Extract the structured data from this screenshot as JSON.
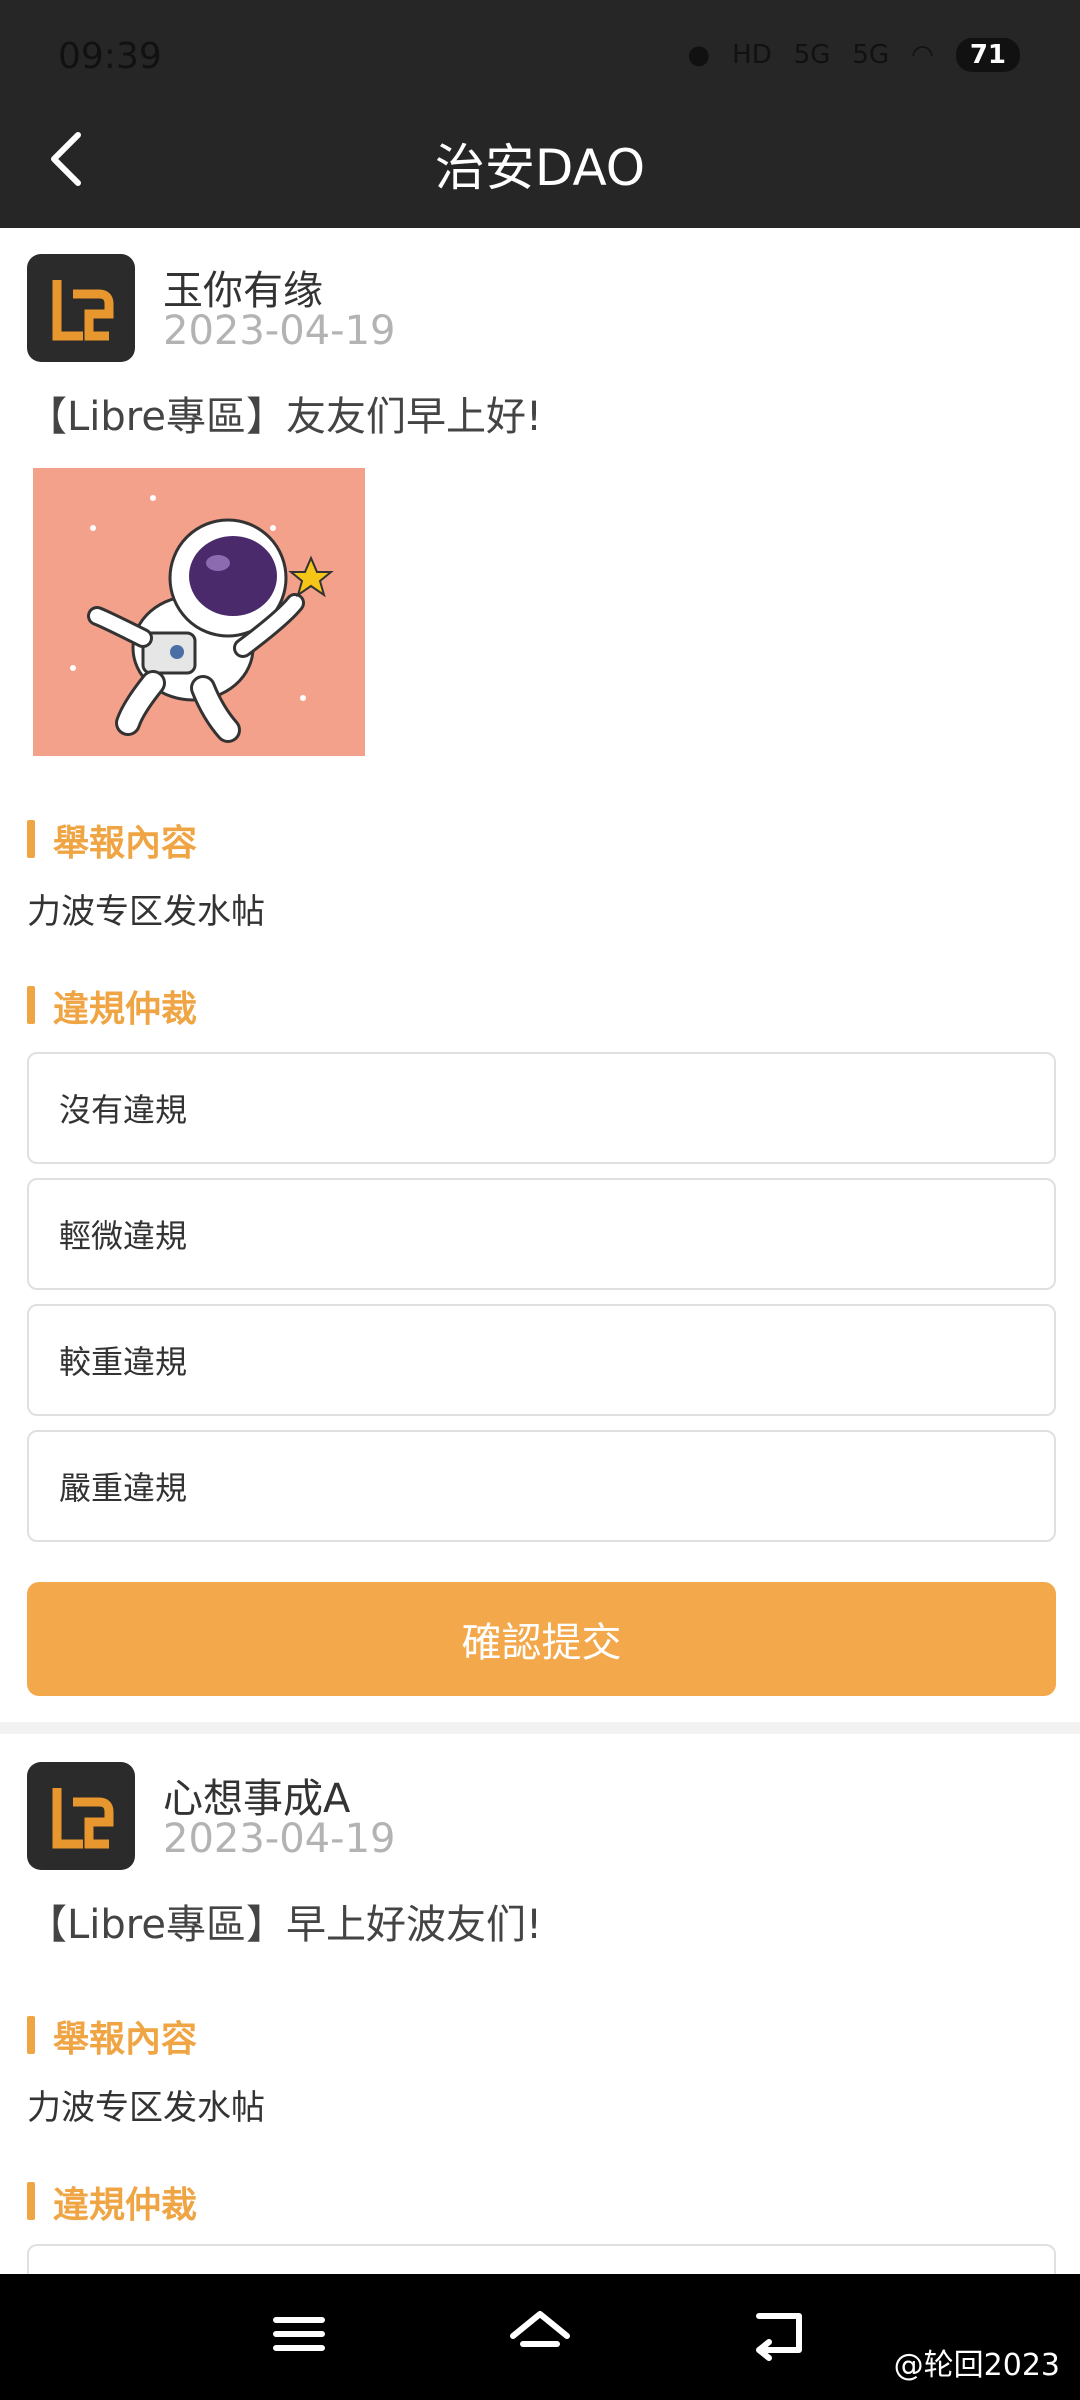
{
  "status": {
    "time": "09:39",
    "battery": "71",
    "network": [
      "HD",
      "5G",
      "5G"
    ]
  },
  "header": {
    "title": "治安DAO"
  },
  "posts": [
    {
      "user": "玉你有缘",
      "date": "2023-04-19",
      "text": "【Libre專區】友友们早上好!",
      "report_title": "舉報內容",
      "report_content": "力波专区发水帖",
      "ruling_title": "違規仲裁",
      "options": [
        "沒有違規",
        "輕微違規",
        "較重違規",
        "嚴重違規"
      ],
      "submit_label": "確認提交"
    },
    {
      "user": "心想事成A",
      "date": "2023-04-19",
      "text": "【Libre專區】早上好波友们!",
      "report_title": "舉報內容",
      "report_content": "力波专区发水帖",
      "ruling_title": "違規仲裁"
    }
  ],
  "watermark": "@轮回2023",
  "colors": {
    "accent": "#f3a84b",
    "header": "#262626"
  }
}
